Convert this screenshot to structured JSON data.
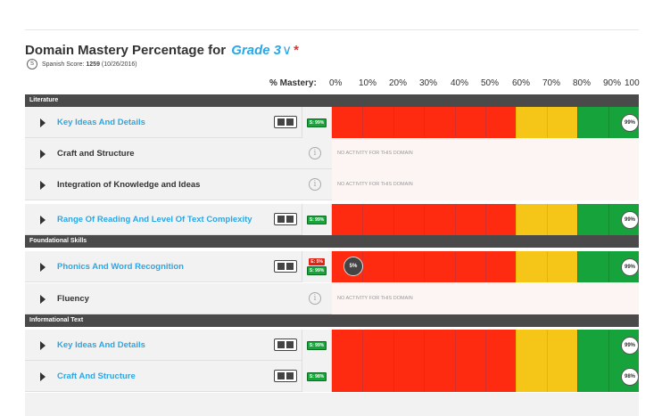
{
  "header": {
    "title_prefix": "Domain Mastery Percentage for",
    "grade": "Grade 3",
    "chevron": "∨",
    "required": "*",
    "score_badge": "S",
    "score_label": "Spanish Score:",
    "score_value": "1259",
    "score_date": "(10/26/2016)"
  },
  "axis": {
    "label": "% Mastery:",
    "ticks": [
      "0%",
      "10%",
      "20%",
      "30%",
      "40%",
      "50%",
      "60%",
      "70%",
      "80%",
      "90%",
      "100"
    ]
  },
  "sections": [
    {
      "title": "Literature"
    },
    {
      "title": "Foundational Skills"
    },
    {
      "title": "Informational Text"
    }
  ],
  "rows": [
    {
      "name": "Key Ideas And Details",
      "link": true,
      "pills": [
        "S: 99%"
      ],
      "mastery": "99%",
      "mastery_value": 99
    },
    {
      "name": "Craft and Structure",
      "link": false,
      "no_activity": "NO ACTIVITY FOR THIS DOMAIN"
    },
    {
      "name": "Integration of Knowledge and Ideas",
      "link": false,
      "no_activity": "NO ACTIVITY FOR THIS DOMAIN"
    },
    {
      "name": "Range Of Reading And Level Of Text Complexity",
      "link": true,
      "pills": [
        "S: 99%"
      ],
      "mastery": "99%",
      "mastery_value": 99
    },
    {
      "name": "Phonics And Word Recognition",
      "link": true,
      "pills": [
        "E: 5%",
        "S: 99%"
      ],
      "english": "5%",
      "english_value": 5,
      "mastery": "99%",
      "mastery_value": 99
    },
    {
      "name": "Fluency",
      "link": false,
      "no_activity": "NO ACTIVITY FOR THIS DOMAIN"
    },
    {
      "name": "Key Ideas And Details",
      "link": true,
      "pills": [
        "S: 99%"
      ],
      "mastery": "99%",
      "mastery_value": 99
    },
    {
      "name": "Craft And Structure",
      "link": true,
      "pills": [
        "S: 98%"
      ],
      "mastery": "98%",
      "mastery_value": 98
    }
  ],
  "icons": {
    "expand": "caret-right-icon",
    "toggle": "toggle-view-icon",
    "info": "info-icon"
  },
  "colors": {
    "red": "#ff2b10",
    "yellow": "#f5c518",
    "green": "#17a33b",
    "link": "#2aa7e6",
    "section": "#4a4a4a"
  }
}
